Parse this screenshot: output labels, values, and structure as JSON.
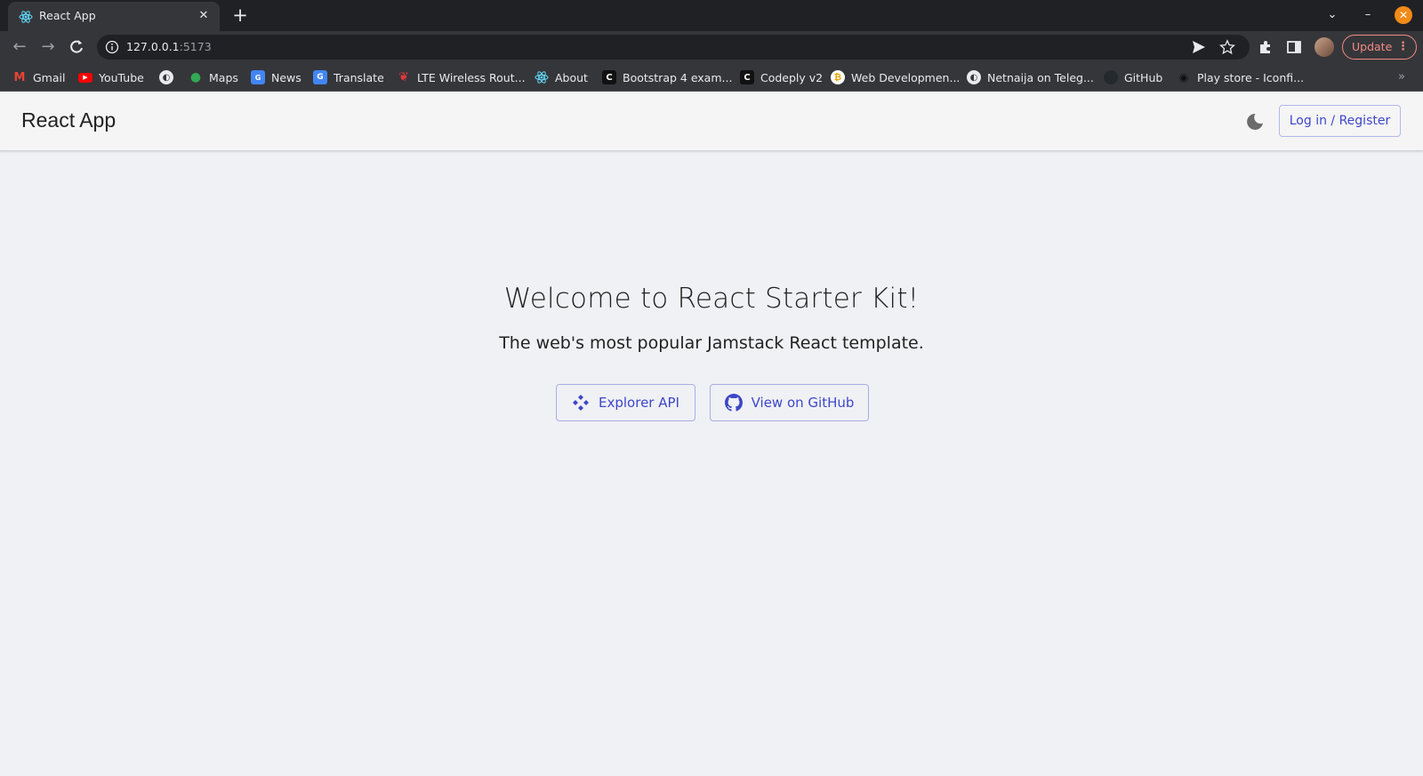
{
  "browser": {
    "tab_title": "React App",
    "url_host": "127.0.0.1",
    "url_port": ":5173",
    "update_label": "Update",
    "bookmarks": [
      {
        "label": "Gmail",
        "icon": "gmail-icon"
      },
      {
        "label": "YouTube",
        "icon": "youtube-icon"
      },
      {
        "label": "",
        "icon": "globe-icon"
      },
      {
        "label": "Maps",
        "icon": "maps-icon"
      },
      {
        "label": "News",
        "icon": "news-icon"
      },
      {
        "label": "Translate",
        "icon": "translate-icon"
      },
      {
        "label": "LTE Wireless Rout...",
        "icon": "router-icon"
      },
      {
        "label": "About",
        "icon": "react-icon"
      },
      {
        "label": "Bootstrap 4 exam...",
        "icon": "codeply-icon"
      },
      {
        "label": "Codeply v2",
        "icon": "codeply-icon"
      },
      {
        "label": "Web Developmen...",
        "icon": "bitcoin-icon"
      },
      {
        "label": "Netnaija on Teleg...",
        "icon": "globe-icon"
      },
      {
        "label": "GitHub",
        "icon": "github-icon"
      },
      {
        "label": "Play store - Iconfi...",
        "icon": "iconfinder-icon"
      }
    ]
  },
  "header": {
    "brand": "React App",
    "login_label": "Log in / Register"
  },
  "hero": {
    "title": "Welcome to React Starter Kit!",
    "subtitle": "The web's most popular Jamstack React template.",
    "explorer_label": "Explorer API",
    "github_label": "View on GitHub"
  },
  "colors": {
    "accent": "#3d47c7",
    "page_bg": "#f0f1f5",
    "chrome_dark": "#202124",
    "chrome_tab": "#35363a",
    "update_accent": "#f28b82"
  }
}
